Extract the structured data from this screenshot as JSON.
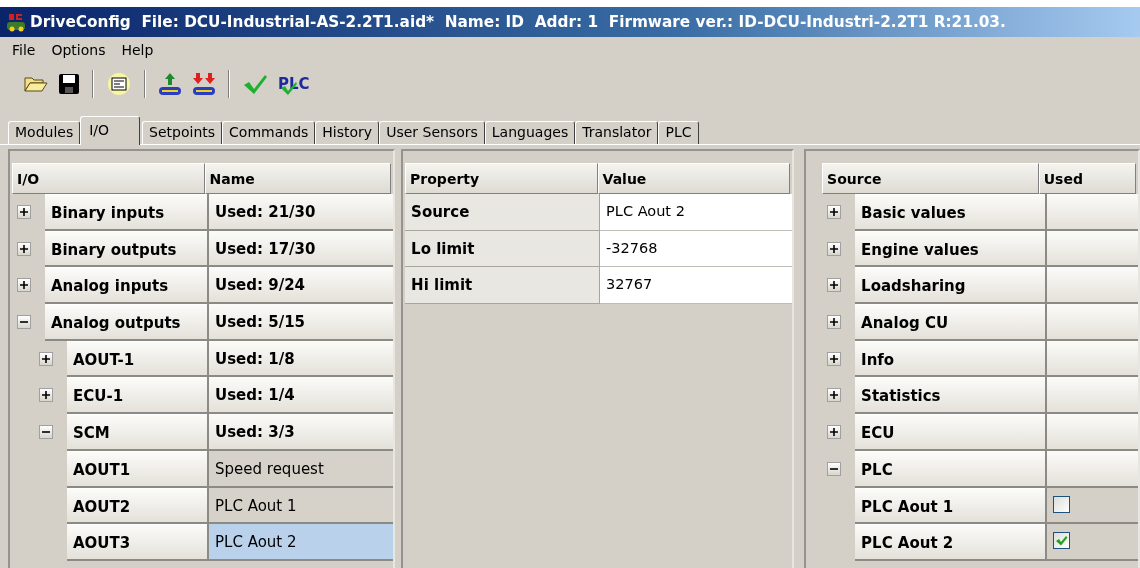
{
  "window": {
    "title": "DriveConfig  File: DCU-Industrial-AS-2.2T1.aid*  Name: ID  Addr: 1  Firmware ver.: ID-DCU-Industri-2.2T1 R:21.03."
  },
  "menu": [
    "File",
    "Options",
    "Help"
  ],
  "toolbar": [
    {
      "kind": "open"
    },
    {
      "kind": "save"
    },
    {
      "kind": "separator"
    },
    {
      "kind": "properties"
    },
    {
      "kind": "separator"
    },
    {
      "kind": "upload"
    },
    {
      "kind": "download"
    },
    {
      "kind": "separator"
    },
    {
      "kind": "check"
    },
    {
      "kind": "plc-check",
      "label": "PLC"
    }
  ],
  "tabs": [
    {
      "label": "Modules",
      "selected": false
    },
    {
      "label": "I/O",
      "selected": true
    },
    {
      "label": "Setpoints",
      "selected": false
    },
    {
      "label": "Commands",
      "selected": false
    },
    {
      "label": "History",
      "selected": false
    },
    {
      "label": "User Sensors",
      "selected": false
    },
    {
      "label": "Languages",
      "selected": false
    },
    {
      "label": "Translator",
      "selected": false
    },
    {
      "label": "PLC",
      "selected": false
    }
  ],
  "io_tree": {
    "columns": [
      "I/O",
      "Name"
    ],
    "items": [
      {
        "label": "Binary inputs",
        "value": "Used: 21/30",
        "expanded": false
      },
      {
        "label": "Binary outputs",
        "value": "Used: 17/30",
        "expanded": false
      },
      {
        "label": "Analog inputs",
        "value": "Used: 9/24",
        "expanded": false
      },
      {
        "label": "Analog outputs",
        "value": "Used: 5/15",
        "expanded": true,
        "children": [
          {
            "label": "AOUT-1",
            "value": "Used: 1/8",
            "expanded": false
          },
          {
            "label": "ECU-1",
            "value": "Used: 1/4",
            "expanded": false
          },
          {
            "label": "SCM",
            "value": "Used: 3/3",
            "expanded": true,
            "children": [
              {
                "label": "AOUT1",
                "value": "Speed request",
                "selected": false
              },
              {
                "label": "AOUT2",
                "value": "PLC Aout 1",
                "selected": false
              },
              {
                "label": "AOUT3",
                "value": "PLC Aout 2",
                "selected": true
              }
            ]
          }
        ]
      }
    ]
  },
  "properties": {
    "columns": [
      "Property",
      "Value"
    ],
    "rows": [
      {
        "property": "Source",
        "value": "PLC Aout 2"
      },
      {
        "property": "Lo limit",
        "value": "-32768"
      },
      {
        "property": "Hi limit",
        "value": "32767"
      }
    ]
  },
  "source_tree": {
    "columns": [
      "Source",
      "Used"
    ],
    "items": [
      {
        "label": "Basic values",
        "expanded": false
      },
      {
        "label": "Engine values",
        "expanded": false
      },
      {
        "label": "Loadsharing",
        "expanded": false
      },
      {
        "label": "Analog CU",
        "expanded": false
      },
      {
        "label": "Info",
        "expanded": false
      },
      {
        "label": "Statistics",
        "expanded": false
      },
      {
        "label": "ECU",
        "expanded": false
      },
      {
        "label": "PLC",
        "expanded": true,
        "children": [
          {
            "label": "PLC Aout 1",
            "checked": false
          },
          {
            "label": "PLC Aout 2",
            "checked": true
          }
        ]
      }
    ]
  }
}
